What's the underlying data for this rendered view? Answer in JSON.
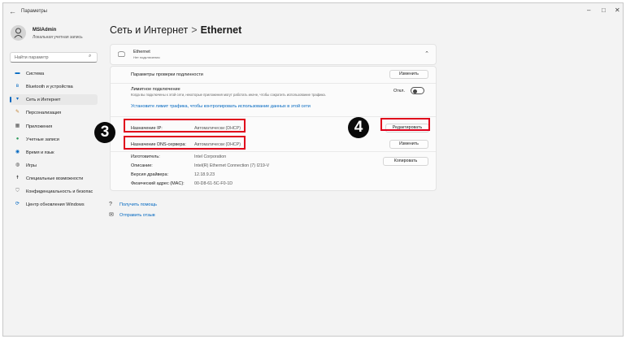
{
  "window": {
    "title": "Параметры",
    "controls": [
      "–",
      "□",
      "✕"
    ]
  },
  "user": {
    "name": "MSIAdmin",
    "account_type": "Локальная учетная запись"
  },
  "search": {
    "placeholder": "Найти параметр"
  },
  "sidebar": {
    "items": [
      {
        "label": "Система",
        "icon": "monitor-icon",
        "color": "#0067c0"
      },
      {
        "label": "Bluetooth и устройства",
        "icon": "bluetooth-icon",
        "color": "#0067c0"
      },
      {
        "label": "Сеть и Интернет",
        "icon": "wifi-icon",
        "color": "#0067c0",
        "active": true
      },
      {
        "label": "Персонализация",
        "icon": "brush-icon",
        "color": "#c08030"
      },
      {
        "label": "Приложения",
        "icon": "apps-icon",
        "color": "#555555"
      },
      {
        "label": "Учетные записи",
        "icon": "person-icon",
        "color": "#2e9a5c"
      },
      {
        "label": "Время и язык",
        "icon": "globe-clock-icon",
        "color": "#0067c0"
      },
      {
        "label": "Игры",
        "icon": "gamepad-icon",
        "color": "#555555"
      },
      {
        "label": "Специальные возможности",
        "icon": "accessibility-icon",
        "color": "#1a1a1a"
      },
      {
        "label": "Конфиденциальность и безопас",
        "icon": "shield-icon",
        "color": "#777777"
      },
      {
        "label": "Центр обновления Windows",
        "icon": "update-icon",
        "color": "#0067c0"
      }
    ]
  },
  "breadcrumb": {
    "parent": "Сеть и Интернет",
    "separator": ">",
    "current": "Ethernet"
  },
  "ethernet": {
    "title": "Ethernet",
    "status": "Нет подключения"
  },
  "auth": {
    "label": "Параметры проверки подлинности",
    "button": "Изменить"
  },
  "metered": {
    "label": "Лимитное подключение",
    "description": "Когда вы подключены к этой сети, некоторые приложения могут работать иначе, чтобы сократить использование трафика.",
    "toggle_state": "Откл.",
    "link": "Установите лимит трафика, чтобы контролировать использование данных в этой сети"
  },
  "ip": {
    "label": "Назначение IP:",
    "value": "Автоматически (DHCP)",
    "button": "Редактировать"
  },
  "dns": {
    "label": "Назначение DNS-сервера:",
    "value": "Автоматически (DHCP)",
    "button": "Изменить"
  },
  "properties": {
    "button": "Копировать",
    "rows": [
      {
        "label": "Изготовитель:",
        "value": "Intel Corporation"
      },
      {
        "label": "Описание:",
        "value": "Intel(R) Ethernet Connection (7) I219-V"
      },
      {
        "label": "Версия драйвера:",
        "value": "12.18.9.23"
      },
      {
        "label": "Физический адрес (MAC):",
        "value": "00-D8-61-5C-F0-1D"
      }
    ]
  },
  "help": {
    "get_help": "Получить помощь",
    "feedback": "Отправить отзыв"
  },
  "annotations": {
    "badge_3": "3",
    "badge_4": "4",
    "highlight_color": "#e0001b"
  }
}
